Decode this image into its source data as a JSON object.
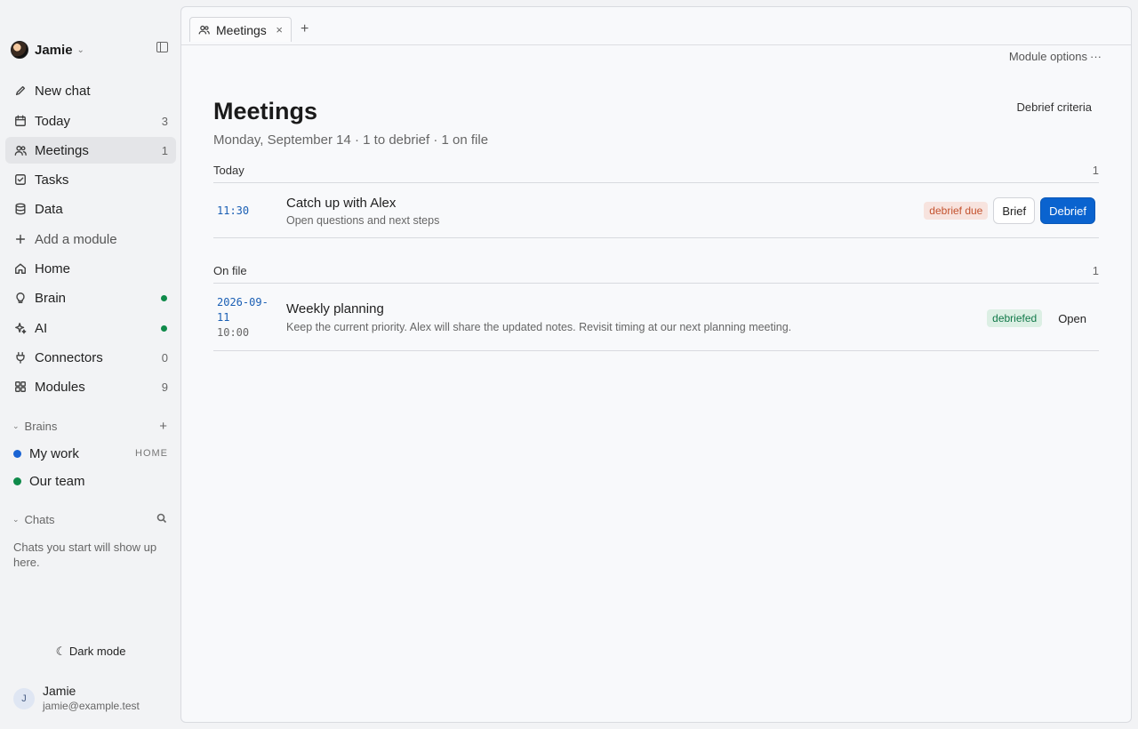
{
  "sidebar": {
    "workspace": {
      "name": "Jamie"
    },
    "nav": [
      {
        "label": "New chat",
        "icon": "pencil-icon",
        "count": ""
      },
      {
        "label": "Today",
        "icon": "calendar-icon",
        "count": "3"
      },
      {
        "label": "Meetings",
        "icon": "people-icon",
        "count": "1"
      },
      {
        "label": "Tasks",
        "icon": "checkbox-icon",
        "count": ""
      },
      {
        "label": "Data",
        "icon": "database-icon",
        "count": ""
      },
      {
        "label": "Add a module",
        "icon": "plus-icon",
        "count": ""
      },
      {
        "label": "Home",
        "icon": "house-icon",
        "count": ""
      },
      {
        "label": "Brain",
        "icon": "bulb-icon",
        "count": ""
      },
      {
        "label": "AI",
        "icon": "sparkle-icon",
        "count": ""
      },
      {
        "label": "Connectors",
        "icon": "plug-icon",
        "count": "0"
      },
      {
        "label": "Modules",
        "icon": "grid-icon",
        "count": "9"
      }
    ],
    "status_color": "#0f8a4a",
    "brains_section": {
      "label": "Brains"
    },
    "brains": [
      {
        "name": "My work",
        "tag": "HOME",
        "color": "#1a64d4"
      },
      {
        "name": "Our team",
        "tag": "",
        "color": "#0f8a4a"
      }
    ],
    "chats_section": {
      "label": "Chats",
      "empty_text": "Chats you start will show up here."
    },
    "dark_mode_label": "Dark mode",
    "user": {
      "initial": "J",
      "name": "Jamie",
      "email": "jamie@example.test"
    }
  },
  "tabs": [
    {
      "label": "Meetings",
      "close": "×"
    }
  ],
  "tab_add": "+",
  "header": {
    "module_options": "Module options",
    "module_options_dots": "···",
    "title": "Meetings",
    "subtitle": "Monday, September 14 · 1 to debrief · 1 on file",
    "debrief_criteria": "Debrief criteria"
  },
  "groups": [
    {
      "label": "Today",
      "count": "1",
      "rows": [
        {
          "time": "11:30",
          "title": "Catch up with Alex",
          "description": "Open questions and next steps",
          "badge": "debrief due",
          "brief_button": "Brief",
          "debrief_button": "Debrief"
        }
      ]
    },
    {
      "label": "On file",
      "count": "1",
      "rows": [
        {
          "date_line1": "2026-09-",
          "date_line2": "11",
          "time": "10:00",
          "title": "Weekly planning",
          "description": "Keep the current priority. Alex will share the updated notes. Revisit timing at our next planning meeting.",
          "badge": "debriefed",
          "open_button": "Open"
        }
      ]
    }
  ],
  "colors": {
    "accent": "#0a63cf",
    "due_badge_bg": "#f7e3de",
    "due_badge_text": "#c4532f",
    "done_badge_bg": "#dcefe4",
    "done_badge_text": "#12794a"
  }
}
